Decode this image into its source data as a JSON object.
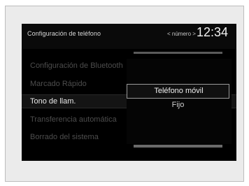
{
  "header": {
    "title": "Configuración de teléfono",
    "status": "< número >",
    "clock": "12:34"
  },
  "menu": {
    "items": [
      {
        "label": "Configuración de Bluetooth",
        "state": "dimmed"
      },
      {
        "label": "Marcado Rápido",
        "state": "dimmed"
      },
      {
        "label": "Tono de llam.",
        "state": "selected"
      },
      {
        "label": "Transferencia automática",
        "state": "dimmed"
      },
      {
        "label": "Borrado del sistema",
        "state": "dimmed"
      }
    ]
  },
  "popup": {
    "options": [
      {
        "label": "Teléfono móvil",
        "selected": true
      },
      {
        "label": "Fijo",
        "selected": false
      }
    ]
  },
  "colors": {
    "screen_background": "#000000",
    "text_active": "#e8e8e8",
    "text_dimmed": "#4d4d4d",
    "option_border": "#9a9a9a"
  }
}
